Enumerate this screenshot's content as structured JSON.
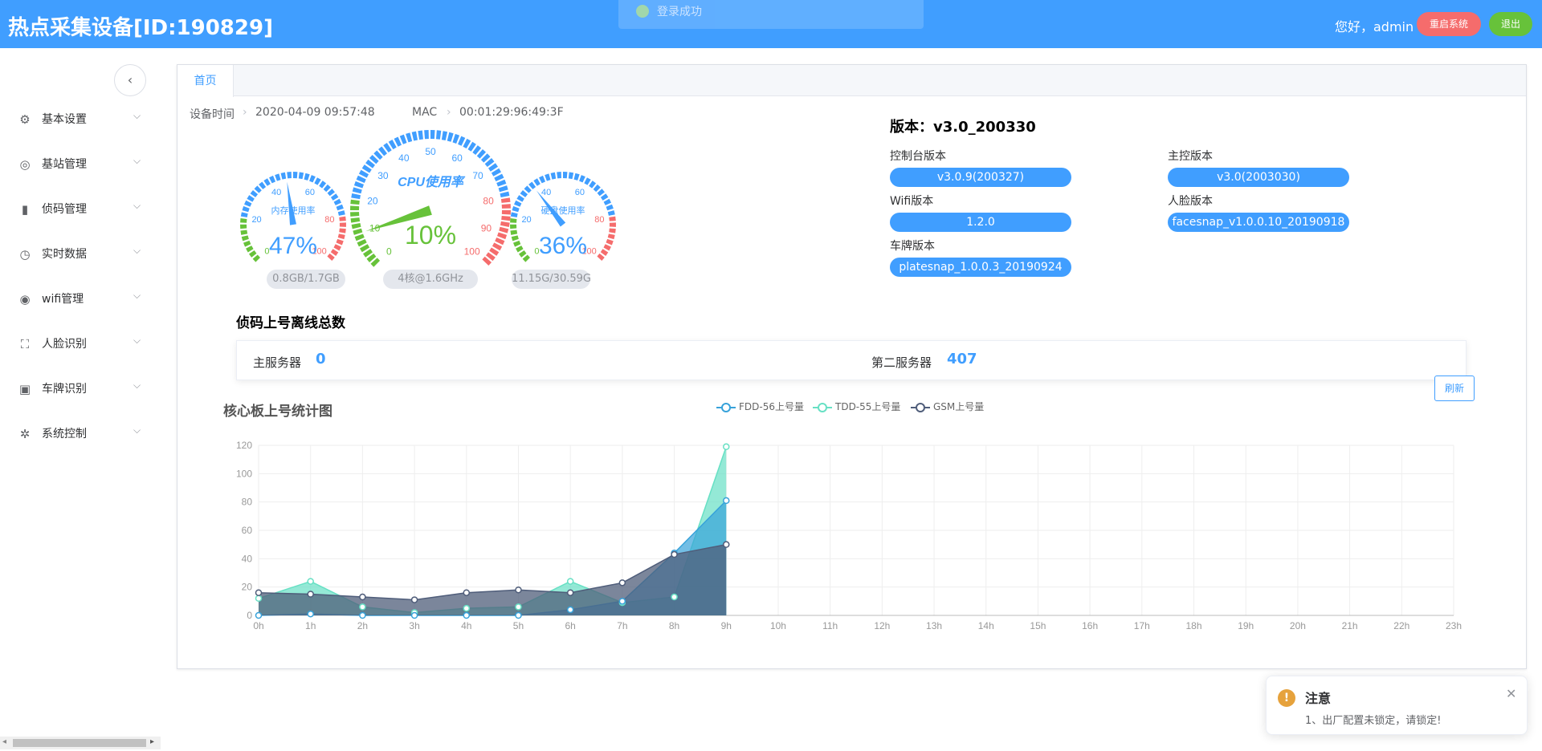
{
  "header": {
    "title": "热点采集设备[ID:190829]",
    "greeting": "您好，admin",
    "restart_label": "重启系统",
    "logout_label": "退出"
  },
  "toast": {
    "text": "登录成功"
  },
  "sidebar": {
    "items": [
      {
        "label": "基本设置",
        "icon": "gear-icon"
      },
      {
        "label": "基站管理",
        "icon": "tower-icon"
      },
      {
        "label": "侦码管理",
        "icon": "bar-chart-icon"
      },
      {
        "label": "实时数据",
        "icon": "clock-icon"
      },
      {
        "label": "wifi管理",
        "icon": "compass-icon"
      },
      {
        "label": "人脸识别",
        "icon": "face-frame-icon"
      },
      {
        "label": "车牌识别",
        "icon": "camera-icon"
      },
      {
        "label": "系统控制",
        "icon": "settings-icon"
      }
    ]
  },
  "tabs": {
    "home": "首页"
  },
  "device": {
    "time_label": "设备时间",
    "time_value": "2020-04-09 09:57:48",
    "mac_label": "MAC",
    "mac_value": "00:01:29:96:49:3F"
  },
  "gauges": {
    "memory": {
      "label": "内存使用率",
      "percent": 47,
      "display": "47%",
      "detail": "0.8GB/1.7GB"
    },
    "cpu": {
      "label": "CPU使用率",
      "percent": 10,
      "display": "10%",
      "detail": "4核@1.6GHz"
    },
    "disk": {
      "label": "硬盘使用率",
      "percent": 36,
      "display": "36%",
      "detail": "11.15G/30.59G"
    },
    "small_ticks": [
      "0",
      "20",
      "40",
      "60",
      "80",
      "100"
    ],
    "cpu_ticks": [
      "0",
      "10",
      "20",
      "30",
      "40",
      "50",
      "60",
      "70",
      "80",
      "90",
      "100"
    ]
  },
  "versions": {
    "title": "版本：v3.0_200330",
    "console_label": "控制台版本",
    "console_value": "v3.0.9(200327)",
    "master_label": "主控版本",
    "master_value": "v3.0(2003030)",
    "wifi_label": "Wifi版本",
    "wifi_value": "1.2.0",
    "face_label": "人脸版本",
    "face_value": "facesnap_v1.0.0.10_20190918",
    "plate_label": "车牌版本",
    "plate_value": "platesnap_1.0.0.3_20190924"
  },
  "offline": {
    "title": "侦码上号离线总数",
    "main_label": "主服务器",
    "main_value": "0",
    "second_label": "第二服务器",
    "second_value": "407",
    "refresh_label": "刷新"
  },
  "notice": {
    "title": "注意",
    "body": "1、出厂配置未锁定，请锁定!"
  },
  "colors": {
    "primary": "#409eff",
    "danger": "#f56c6c",
    "success": "#67c23a",
    "warning": "#e6a23c",
    "fdd": "#37a2da",
    "tdd": "#67e0c4",
    "gsm": "#4f5d7a"
  },
  "chart_data": {
    "type": "area",
    "title": "核心板上号统计图",
    "x": [
      "0h",
      "1h",
      "2h",
      "3h",
      "4h",
      "5h",
      "6h",
      "7h",
      "8h",
      "9h",
      "10h",
      "11h",
      "12h",
      "13h",
      "14h",
      "15h",
      "16h",
      "17h",
      "18h",
      "19h",
      "20h",
      "21h",
      "22h",
      "23h"
    ],
    "ylim": [
      0,
      120
    ],
    "yticks": [
      0,
      20,
      40,
      60,
      80,
      100,
      120
    ],
    "grid": true,
    "legend": "top-center",
    "series": [
      {
        "name": "FDD-56上号量",
        "color": "#37a2da",
        "values": [
          0,
          1,
          0,
          0,
          0,
          0,
          4,
          10,
          44,
          81
        ]
      },
      {
        "name": "TDD-55上号量",
        "color": "#67e0c4",
        "values": [
          12,
          24,
          6,
          2,
          5,
          6,
          24,
          9,
          13,
          119
        ]
      },
      {
        "name": "GSM上号量",
        "color": "#4f5d7a",
        "values": [
          16,
          15,
          13,
          11,
          16,
          18,
          16,
          23,
          43,
          50
        ]
      }
    ]
  }
}
